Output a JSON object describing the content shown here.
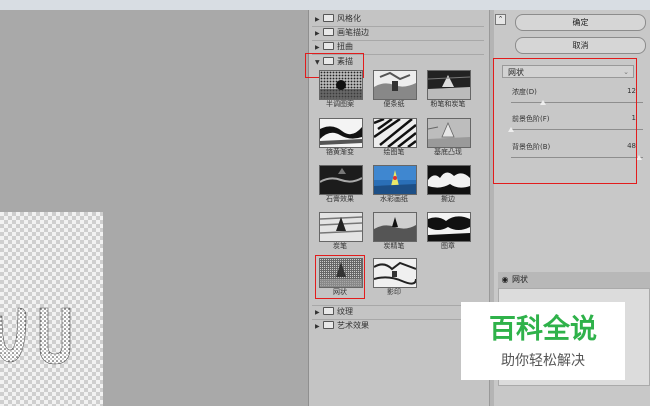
{
  "gallery": {
    "categories_top": [
      {
        "label": "风格化",
        "expanded": false
      },
      {
        "label": "画笔描边",
        "expanded": false
      },
      {
        "label": "扭曲",
        "expanded": false
      },
      {
        "label": "素描",
        "expanded": true
      }
    ],
    "thumbnails": [
      {
        "label": "半调图案"
      },
      {
        "label": "便条纸"
      },
      {
        "label": "粉笔和炭笔"
      },
      {
        "label": "铬黄渐变"
      },
      {
        "label": "绘图笔"
      },
      {
        "label": "基底凸现"
      },
      {
        "label": "石膏效果"
      },
      {
        "label": "水彩画纸"
      },
      {
        "label": "撕边"
      },
      {
        "label": "炭笔"
      },
      {
        "label": "炭精笔"
      },
      {
        "label": "图章"
      },
      {
        "label": "网状",
        "selected": true
      },
      {
        "label": "影印"
      }
    ],
    "categories_bottom": [
      {
        "label": "纹理",
        "expanded": false
      },
      {
        "label": "艺术效果",
        "expanded": false
      }
    ]
  },
  "buttons": {
    "ok_label": "确定",
    "cancel_label": "取消"
  },
  "filter": {
    "selected": "网状",
    "params": [
      {
        "label": "浓度(D)",
        "value": "12",
        "fraction": 0.24
      },
      {
        "label": "前景色阶(F)",
        "value": "1",
        "fraction": 0.0
      },
      {
        "label": "背景色阶(B)",
        "value": "48",
        "fraction": 0.97
      }
    ]
  },
  "layers": [
    {
      "label": "网状",
      "visible": true
    }
  ],
  "watermark": {
    "title": "百科全说",
    "subtitle": "助你轻松解决"
  },
  "colors": {
    "highlight_red": "#e21c1c",
    "watermark_green": "#2fb24a"
  }
}
